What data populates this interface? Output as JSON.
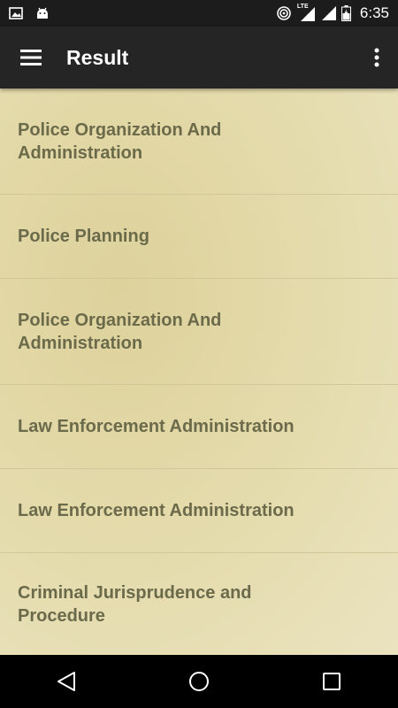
{
  "status_bar": {
    "time": "6:35",
    "network_label": "LTE",
    "icons": [
      "image-icon",
      "android-icon",
      "hotspot-icon",
      "signal-lte-icon",
      "signal-icon",
      "battery-icon"
    ]
  },
  "app_bar": {
    "title": "Result",
    "menu_icon": "hamburger-menu-icon",
    "overflow_icon": "more-vert-icon",
    "background": "#252525"
  },
  "results": {
    "items": [
      {
        "label": "Police Organization And Administration"
      },
      {
        "label": "Police Planning"
      },
      {
        "label": "Police Organization And Administration"
      },
      {
        "label": "Law Enforcement Administration"
      },
      {
        "label": "Law Enforcement Administration"
      },
      {
        "label": "Criminal Jurisprudence and Procedure"
      }
    ],
    "text_color": "#6b6a4b",
    "background_color": "#e7dfb4"
  },
  "nav_bar": {
    "icons": [
      "back-icon",
      "home-icon",
      "recents-icon"
    ]
  }
}
